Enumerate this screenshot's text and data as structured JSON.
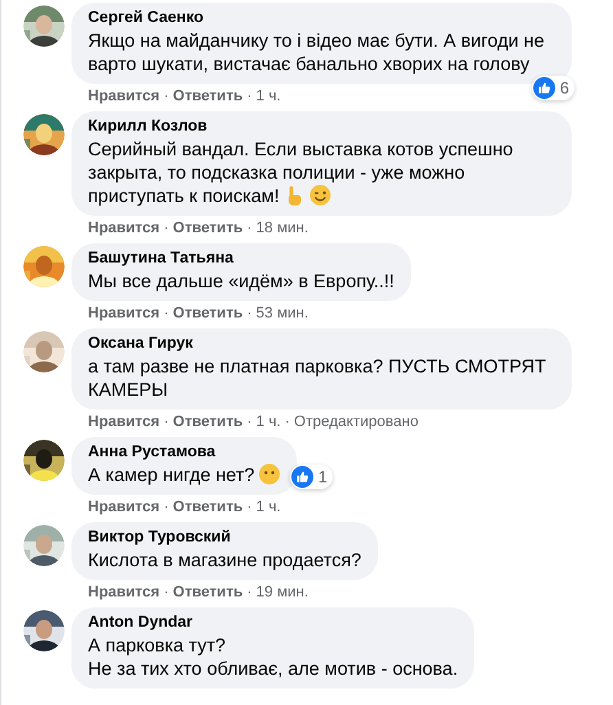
{
  "comments": [
    {
      "author": "Сергей Саенко",
      "text": "Якщо на майданчику то і відео має бути. А вигоди не варто шукати, вистачає банально хворих на голову",
      "avatar": {
        "kind": "picture"
      },
      "reaction": {
        "count": "6"
      },
      "meta": {
        "like": "Нравится",
        "sep": "·",
        "reply": "Ответить",
        "time": "1 ч."
      }
    },
    {
      "author": "Кирилл Козлов",
      "text": "Серийный вандал. Если выставка котов успешно закрыта, то подсказка полиции - уже можно приступать к поискам!",
      "emojis": [
        {
          "kind": "pointing-hand"
        },
        {
          "kind": "winking-face"
        }
      ],
      "avatar": {
        "kind": "picture"
      },
      "meta": {
        "like": "Нравится",
        "sep": "·",
        "reply": "Ответить",
        "time": "18 мин."
      }
    },
    {
      "author": "Башутина Татьяна",
      "text": "Мы все дальше «идём» в Европу..!!",
      "avatar": {
        "kind": "picture"
      },
      "meta": {
        "like": "Нравится",
        "sep": "·",
        "reply": "Ответить",
        "time": "53 мин."
      }
    },
    {
      "author": "Оксана Гирук",
      "text": "а там разве не платная парковка? ПУСТЬ СМОТРЯТ КАМЕРЫ",
      "avatar": {
        "kind": "picture"
      },
      "meta": {
        "like": "Нравится",
        "sep": "·",
        "reply": "Ответить",
        "time": "1 ч.",
        "edited": "Отредактировано"
      }
    },
    {
      "author": "Анна Рустамова",
      "text": "А камер нигде нет?",
      "emojis": [
        {
          "kind": "blank-face"
        }
      ],
      "avatar": {
        "kind": "picture"
      },
      "reaction": {
        "count": "1"
      },
      "meta": {
        "like": "Нравится",
        "sep": "·",
        "reply": "Ответить",
        "time": "1 ч."
      }
    },
    {
      "author": "Виктор Туровский",
      "text": "Кислота в магазине продается?",
      "avatar": {
        "kind": "picture"
      },
      "meta": {
        "like": "Нравится",
        "sep": "·",
        "reply": "Ответить",
        "time": "19 мин."
      }
    },
    {
      "author": "Anton Dyndar",
      "text": "А парковка тут?\nНе за тих хто обливає, але мотив - основа.",
      "avatar": {
        "kind": "picture"
      }
    }
  ]
}
